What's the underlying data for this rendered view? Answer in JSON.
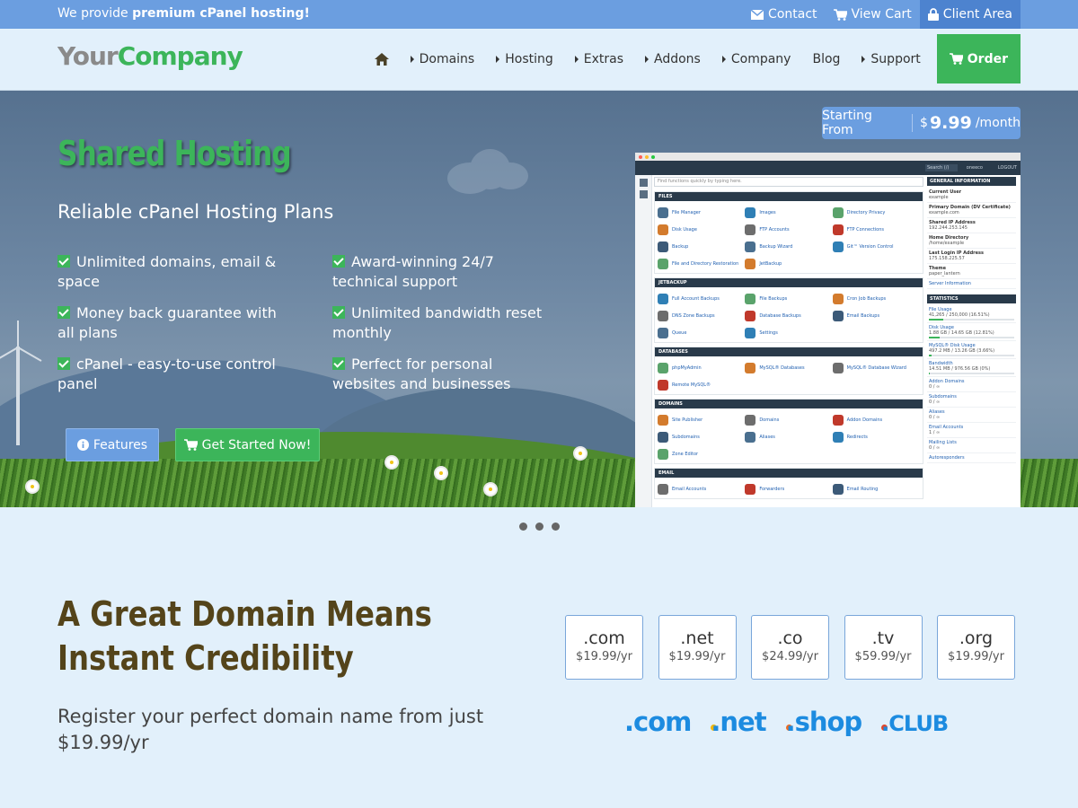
{
  "topbar": {
    "promo_prefix": "We provide ",
    "promo_bold": "premium cPanel hosting!",
    "links": {
      "contact": "Contact",
      "view_cart": "View Cart",
      "client_area": "Client Area"
    }
  },
  "header": {
    "logo_part1": "Your",
    "logo_part2": "Company",
    "nav": {
      "domains": "Domains",
      "hosting": "Hosting",
      "extras": "Extras",
      "addons": "Addons",
      "company": "Company",
      "blog": "Blog",
      "support": "Support",
      "order": "Order"
    }
  },
  "hero": {
    "title": "Shared Hosting",
    "subtitle": "Reliable cPanel Hosting Plans",
    "features": [
      "Unlimited domains, email & space",
      "Award-winning 24/7 technical support",
      "Money back guarantee with all plans",
      "Unlimited bandwidth reset monthly",
      "cPanel - easy-to-use control panel",
      "Perfect for personal websites and businesses"
    ],
    "buttons": {
      "features": "Features",
      "get_started": "Get Started Now!"
    },
    "price": {
      "label": "Starting From",
      "currency": "$",
      "amount": "9.99",
      "period": "/month"
    },
    "colors": {
      "accent_green": "#3cb55a",
      "accent_blue": "#6b9ee0"
    }
  },
  "cpanel": {
    "search_placeholder": "Find functions quickly by typing here.",
    "top_search": "Search (/)",
    "top_user": "oneeco",
    "top_logout": "LOGOUT",
    "sections": [
      {
        "title": "FILES",
        "items": [
          "File Manager",
          "Images",
          "Directory Privacy",
          "Disk Usage",
          "FTP Accounts",
          "FTP Connections",
          "Backup",
          "Backup Wizard",
          "Git™ Version Control",
          "File and Directory Restoration",
          "JetBackup"
        ]
      },
      {
        "title": "JETBACKUP",
        "items": [
          "Full Account Backups",
          "File Backups",
          "Cron Job Backups",
          "DNS Zone Backups",
          "Database Backups",
          "Email Backups",
          "Queue",
          "Settings"
        ]
      },
      {
        "title": "DATABASES",
        "items": [
          "phpMyAdmin",
          "MySQL® Databases",
          "MySQL® Database Wizard",
          "Remote MySQL®"
        ]
      },
      {
        "title": "DOMAINS",
        "items": [
          "Site Publisher",
          "Domains",
          "Addon Domains",
          "Subdomains",
          "Aliases",
          "Redirects",
          "Zone Editor"
        ]
      },
      {
        "title": "EMAIL",
        "items": [
          "Email Accounts",
          "Forwarders",
          "Email Routing"
        ]
      }
    ],
    "general_info": {
      "title": "GENERAL INFORMATION",
      "rows": [
        {
          "k": "Current User",
          "v": "example"
        },
        {
          "k": "Primary Domain (DV Certificate)",
          "v": "example.com"
        },
        {
          "k": "Shared IP Address",
          "v": "192.244.253.145"
        },
        {
          "k": "Home Directory",
          "v": "/home/example"
        },
        {
          "k": "Last Login IP Address",
          "v": "175.158.225.57"
        },
        {
          "k": "Theme",
          "v": "paper_lantern"
        }
      ],
      "server_info": "Server Information"
    },
    "statistics": {
      "title": "STATISTICS",
      "rows": [
        {
          "k": "File Usage",
          "v": "41,265 / 250,000  (16.51%)",
          "pct": 0.1651
        },
        {
          "k": "Disk Usage",
          "v": "1.88 GB / 14.65 GB  (12.81%)",
          "pct": 0.1281
        },
        {
          "k": "MySQL® Disk Usage",
          "v": "497.2 MB / 13.26 GB  (3.66%)",
          "pct": 0.0366
        },
        {
          "k": "Bandwidth",
          "v": "14.51 MB / 976.56 GB  (0%)",
          "pct": 0.0
        },
        {
          "k": "Addon Domains",
          "v": "0 / ∞"
        },
        {
          "k": "Subdomains",
          "v": "0 / ∞"
        },
        {
          "k": "Aliases",
          "v": "0 / ∞"
        },
        {
          "k": "Email Accounts",
          "v": "1 / ∞"
        },
        {
          "k": "Mailing Lists",
          "v": "0 / ∞"
        },
        {
          "k": "Autoresponders",
          "v": ""
        }
      ]
    }
  },
  "slider": {
    "dots": 3
  },
  "domains": {
    "heading": "A Great Domain Means Instant Credibility",
    "subtext": "Register your perfect domain name from just $19.99/yr",
    "tlds": [
      {
        "ext": ".com",
        "price": "$19.99/yr"
      },
      {
        "ext": ".net",
        "price": "$19.99/yr"
      },
      {
        "ext": ".co",
        "price": "$24.99/yr"
      },
      {
        "ext": ".tv",
        "price": "$59.99/yr"
      },
      {
        "ext": ".org",
        "price": "$19.99/yr"
      }
    ],
    "brand_logos": [
      ".com",
      ".net",
      ".shop",
      ".CLUB"
    ]
  }
}
